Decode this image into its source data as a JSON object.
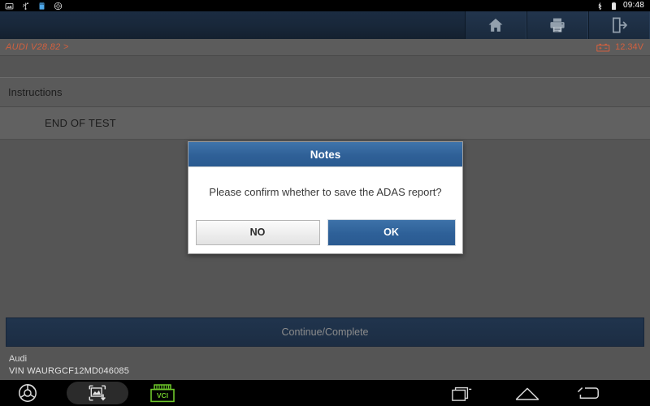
{
  "status_bar": {
    "left_icons": [
      "screenshot-icon",
      "usb-icon",
      "sdcard-icon",
      "adas-app-icon"
    ],
    "bluetooth_icon": "bluetooth-icon",
    "battery_icon": "battery-icon",
    "time": "09:48"
  },
  "toolbar": {
    "buttons": [
      {
        "name": "home-button",
        "icon": "home-icon"
      },
      {
        "name": "print-button",
        "icon": "printer-icon"
      },
      {
        "name": "exit-button",
        "icon": "exit-icon"
      }
    ]
  },
  "vehicle_strip": {
    "software": "AUDI V28.82 >",
    "voltage": "12.34V",
    "voltage_icon": "battery-voltage-icon",
    "accent_color": "#d1603f"
  },
  "main": {
    "section_header": "Instructions",
    "rows": [
      {
        "label": "END OF TEST"
      }
    ],
    "continue_button": "Continue/Complete"
  },
  "footer": {
    "make": "Audi",
    "vin": "VIN WAURGCF12MD046085"
  },
  "dialog": {
    "title": "Notes",
    "message": "Please confirm whether to save the ADAS report?",
    "buttons": [
      {
        "name": "no-button",
        "label": "NO"
      },
      {
        "name": "ok-button",
        "label": "OK"
      }
    ],
    "header_color": "#2f6097",
    "ok_color": "#2e6098"
  },
  "nav_bar": {
    "items": [
      {
        "name": "diag-logo-icon",
        "label": "diag-logo"
      },
      {
        "name": "screenshot-save-icon",
        "label": "screenshot-save"
      },
      {
        "name": "vci-icon",
        "label": "VCI"
      },
      {
        "name": "recents-icon",
        "label": "recents"
      },
      {
        "name": "home-nav-icon",
        "label": "home"
      },
      {
        "name": "back-nav-icon",
        "label": "back"
      }
    ],
    "vci_label": "VCI",
    "vci_color": "#6ec72a"
  }
}
